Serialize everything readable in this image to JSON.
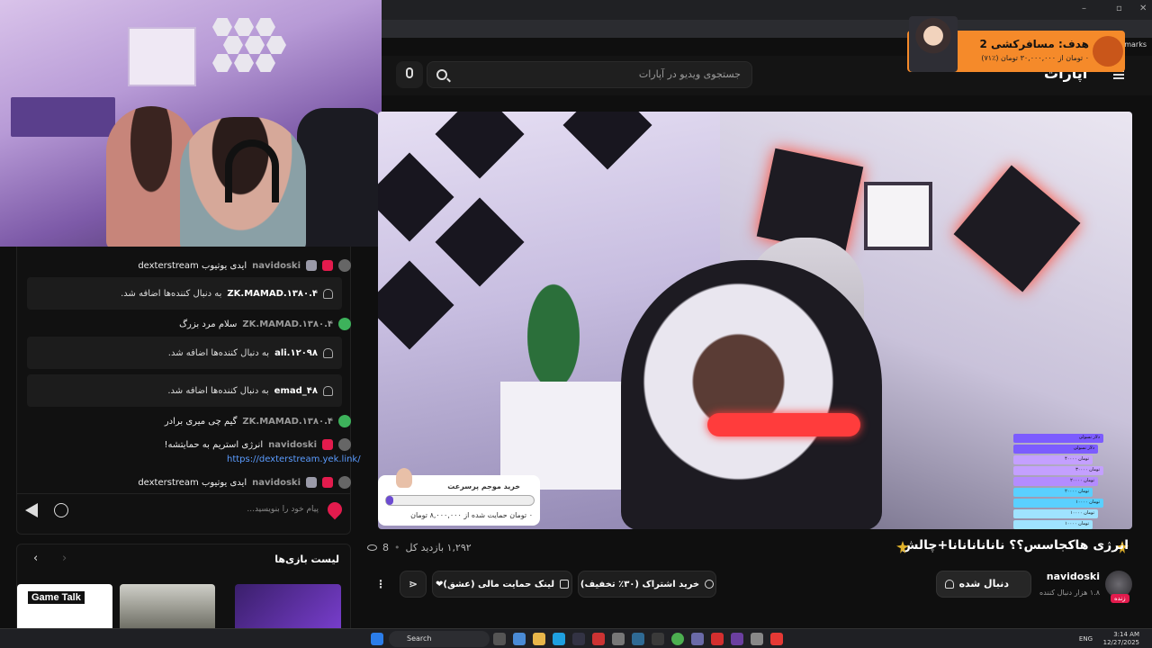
{
  "browser": {
    "bookmarks_label": "Bookmarks"
  },
  "ad": {
    "title": "هدف: مسافرکشی 2",
    "subtitle": "٠ تومان از ۳۰,۰۰۰,۰۰۰ تومان (٪۷١)"
  },
  "header": {
    "logo": "آپارات",
    "search_placeholder": "جستجوی ویدیو در آپارات"
  },
  "video": {
    "title": "انرژی هاکجاسس؟؟ نانانانانانا+چالش",
    "views": "۱,۲۹۲ بازدید کل",
    "likes": "8",
    "donate_title": "خرید موجم پرسرعت",
    "donate_amount": "۰ تومان حمایت شده از ۸,۰۰۰,۰۰۰ تومان",
    "donate_progress": 0.05,
    "leaderboard": [
      "دلار نسولی",
      "دلار نسولی",
      "تومان ۴۰۰۰۰",
      "تومان ۳۰۰۰۰",
      "تومان ۲۰۰۰۰",
      "تومان ۲۰۰۰۰",
      "تومان ۱۰۰۰۰",
      "تومان ۱۰۰۰۰",
      "تومان ۱۰۰۰۰",
      "تومان ۱۰۰۰۰"
    ]
  },
  "channel": {
    "name": "navidoski",
    "followers": "۱.۸ هزار دنبال کننده",
    "live_badge": "زنده",
    "follow_label": "دنبال شده"
  },
  "actions": {
    "subscribe": "خرید اشتراک (۳۰٪ تخفیف)",
    "support_link": "لینک حمایت مالی (عشق)❤"
  },
  "chat": {
    "messages": [
      {
        "user": "navidoski",
        "text": "ایدی یوتیوب dexterstream"
      },
      {
        "user": "ZK.MAMAD.۱۳۸۰.۴",
        "text": "سلام مرد بزرگ"
      },
      {
        "user": "ZK.MAMAD.۱۳۸۰.۴",
        "text": "گیم چی میری برادر"
      },
      {
        "user": "navidoski",
        "text": "انرژی استریم به حمایتشه!"
      },
      {
        "user": "navidoski",
        "text": "ایدی یوتیوب dexterstream"
      }
    ],
    "notices": [
      {
        "user": "ZK.MAMAD.۱۳۸۰.۴",
        "text": "به دنبال کننده‌ها اضافه شد."
      },
      {
        "user": "ali.۱۲۰۹۸",
        "text": "به دنبال کننده‌ها اضافه شد."
      },
      {
        "user": "emad_۴۸",
        "text": "به دنبال کننده‌ها اضافه شد."
      }
    ],
    "link": "https://dexterstream.yek.link/",
    "input_placeholder": "پیام خود را بنویسید..."
  },
  "games": {
    "title": "لیست بازی‌ها",
    "cards": [
      {
        "label": "Game Talk"
      },
      {
        "label": ""
      },
      {
        "label": ""
      }
    ]
  },
  "taskbar": {
    "search": "Search",
    "lang": "ENG",
    "time": "3:14 AM",
    "date": "12/27/2025"
  },
  "colors": {
    "accent": "#e31b4d",
    "ad": "#f58a2a",
    "link": "#5b9cff"
  }
}
